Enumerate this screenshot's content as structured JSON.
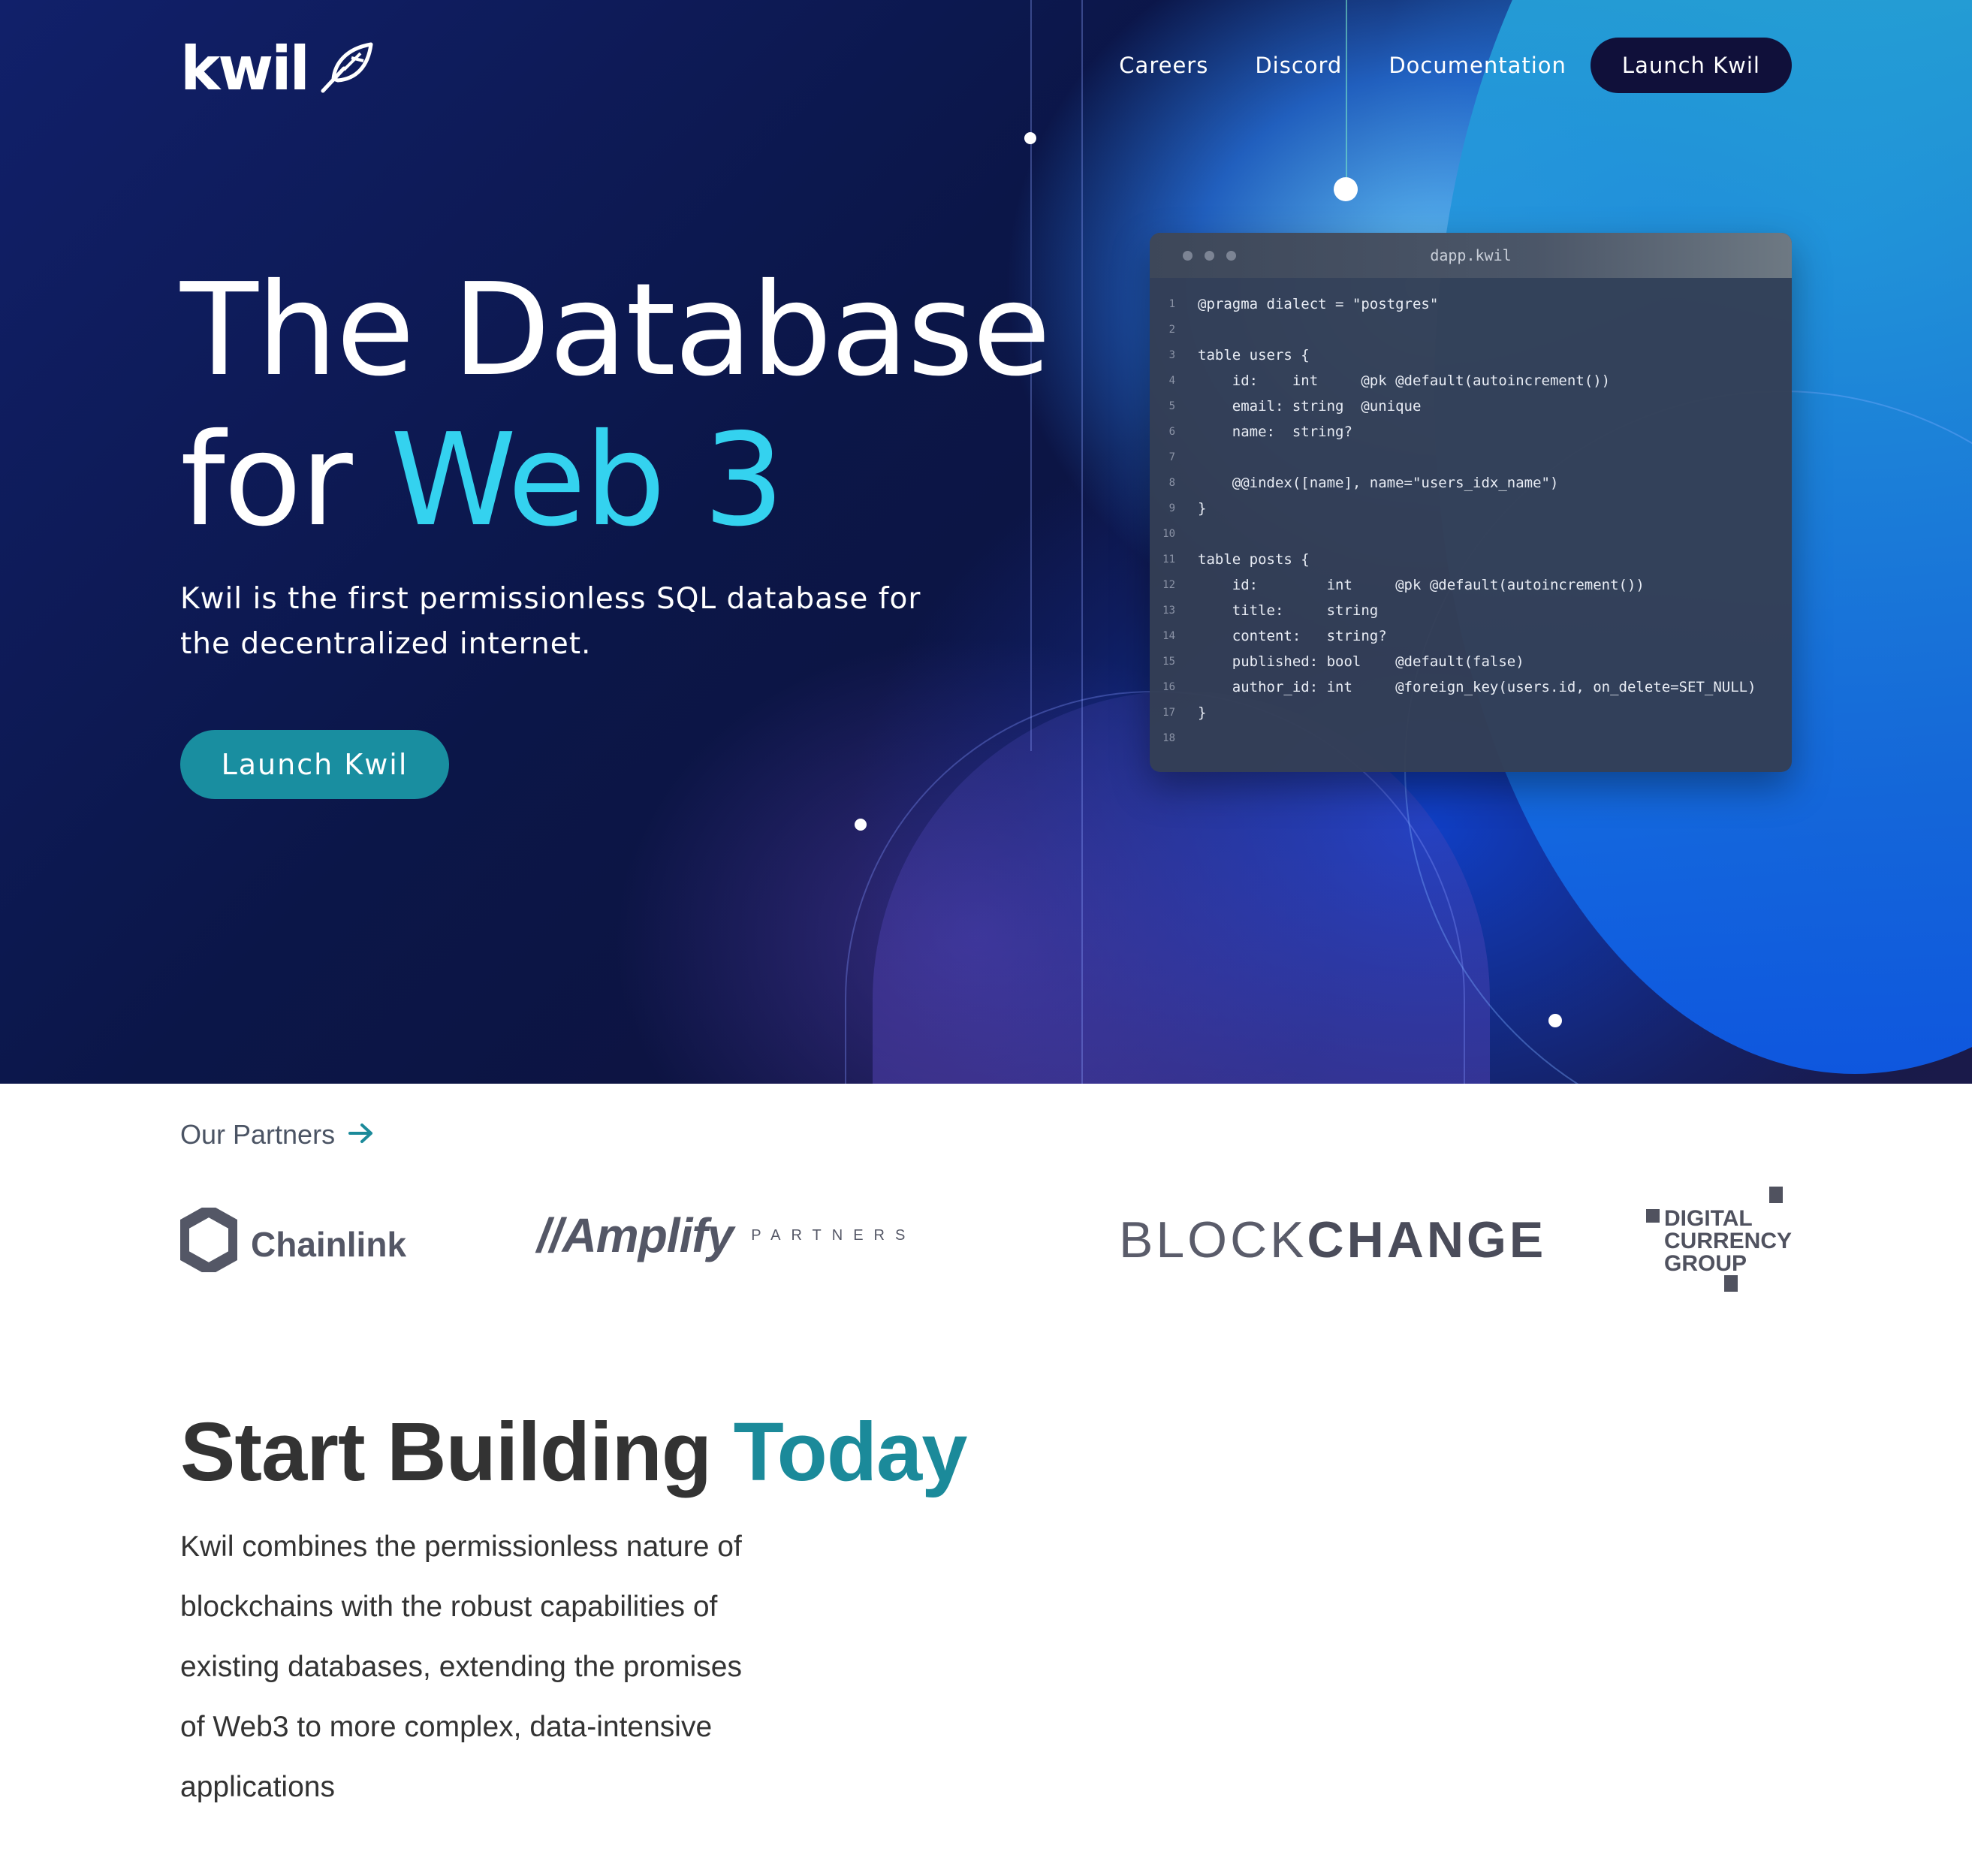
{
  "brand": {
    "name": "kwil",
    "logo_icon": "quill-icon"
  },
  "nav": {
    "links": [
      "Careers",
      "Discord",
      "Documentation"
    ],
    "cta": "Launch Kwil"
  },
  "hero": {
    "title_line1": "The Database",
    "title_line2_prefix": "for ",
    "title_line2_accent": "Web 3",
    "subtitle": "Kwil is the first permissionless SQL database for the decentralized internet.",
    "cta": "Launch Kwil"
  },
  "editor": {
    "filename": "dapp.kwil",
    "lines": [
      {
        "n": "1",
        "t": "@pragma dialect = \"postgres\""
      },
      {
        "n": "2",
        "t": ""
      },
      {
        "n": "3",
        "t": "table users {"
      },
      {
        "n": "4",
        "t": "    id:    int     @pk @default(autoincrement())"
      },
      {
        "n": "5",
        "t": "    email: string  @unique"
      },
      {
        "n": "6",
        "t": "    name:  string?"
      },
      {
        "n": "7",
        "t": ""
      },
      {
        "n": "8",
        "t": "    @@index([name], name=\"users_idx_name\")"
      },
      {
        "n": "9",
        "t": "}"
      },
      {
        "n": "10",
        "t": ""
      },
      {
        "n": "11",
        "t": "table posts {"
      },
      {
        "n": "12",
        "t": "    id:        int     @pk @default(autoincrement())"
      },
      {
        "n": "13",
        "t": "    title:     string"
      },
      {
        "n": "14",
        "t": "    content:   string?"
      },
      {
        "n": "15",
        "t": "    published: bool    @default(false)"
      },
      {
        "n": "16",
        "t": "    author_id: int     @foreign_key(users.id, on_delete=SET_NULL)"
      },
      {
        "n": "17",
        "t": "}"
      },
      {
        "n": "18",
        "t": ""
      }
    ]
  },
  "partners": {
    "label": "Our Partners",
    "items": [
      {
        "name": "Chainlink",
        "icon": "chainlink-hexagon-icon"
      },
      {
        "name": "//Amplify",
        "sub": "PARTNERS"
      },
      {
        "name_thin": "BLOCK",
        "name_bold": "CHANGE"
      },
      {
        "lines": [
          "DIGITAL",
          "CURRENCY",
          "GROUP"
        ]
      }
    ]
  },
  "section": {
    "title_prefix": "Start Building ",
    "title_accent": "Today",
    "body": "Kwil combines the permissionless nature of blockchains with the robust capabilities of existing databases, extending the promises of Web3 to more complex, data-intensive applications"
  },
  "colors": {
    "accent_cyan": "#34d2ef",
    "accent_teal": "#198ea0",
    "nav_button": "#10103a"
  }
}
